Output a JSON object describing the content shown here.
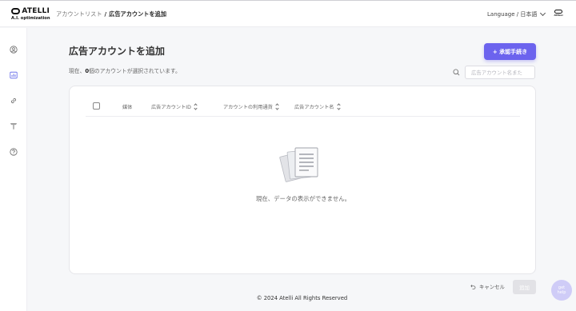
{
  "brand": {
    "name": "ATELLI",
    "tagline": "A.I. optimization",
    "avatar_text": "ATELLI"
  },
  "breadcrumb": {
    "parent": "アカウントリスト",
    "separator": "/",
    "current": "広告アカウントを追加"
  },
  "language": {
    "label": "Language / 日本語"
  },
  "sidebar": {
    "items": [
      {
        "icon": "user-circle-icon"
      },
      {
        "icon": "chart-icon"
      },
      {
        "icon": "link-icon"
      },
      {
        "icon": "text-format-icon"
      },
      {
        "icon": "help-circle-icon"
      }
    ]
  },
  "page": {
    "title": "広告アカウントを追加",
    "selected_prefix": "現在、",
    "selected_count": "0",
    "selected_suffix": "個のアカウントが選択されています。",
    "add_button": "+ 承認手続き"
  },
  "search": {
    "placeholder": "広告アカウント名また"
  },
  "table": {
    "columns": [
      {
        "label": "媒体",
        "sortable": false
      },
      {
        "label": "広告アカウントID",
        "sortable": true
      },
      {
        "label": "アカウントの利用通貨",
        "sortable": true
      },
      {
        "label": "広告アカウント名",
        "sortable": true
      }
    ],
    "rows": [],
    "empty_message": "現在、データの表示ができません。"
  },
  "actions": {
    "cancel": "キャンセル",
    "submit": "追加"
  },
  "footer": {
    "copyright": "© 2024 Atelli All Rights Reserved"
  },
  "help_fab": {
    "line1": "get",
    "line2": "help"
  },
  "colors": {
    "accent": "#6c63ee",
    "background": "#f6f7f9",
    "disabled": "#e2e2e6"
  }
}
